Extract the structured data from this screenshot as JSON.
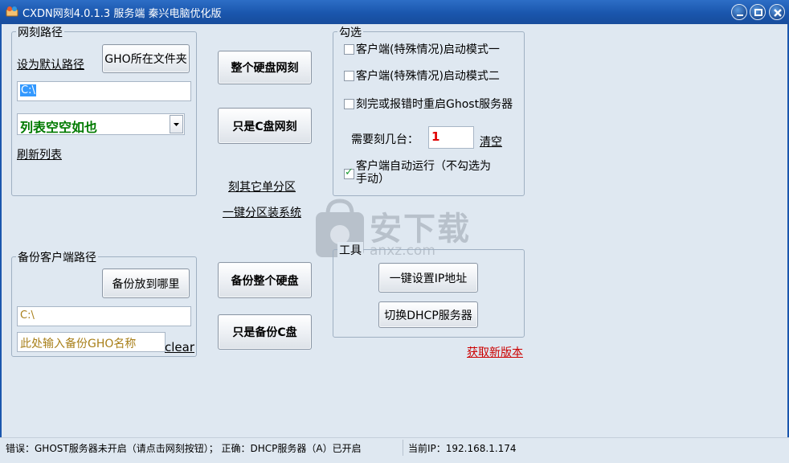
{
  "window": {
    "title": "CXDN网刻4.0.1.3 服务端 秦兴电脑优化版",
    "icon": "app-icon",
    "controls": [
      "minimize-icon",
      "maximize-icon",
      "close-icon"
    ]
  },
  "netclone_path": {
    "legend": "网刻路径",
    "set_default_link": "设为默认路径",
    "gho_folder_button": "GHO所在文件夹",
    "path_value": "C:\\",
    "list_value": "列表空空如也",
    "refresh_link": "刷新列表"
  },
  "center_buttons": {
    "whole_disk_clone": "整个硬盘网刻",
    "c_only_clone": "只是C盘网刻",
    "single_partition_link": "刻其它单分区",
    "one_key_partition_link": "一键分区装系统",
    "backup_whole_disk": "备份整个硬盘",
    "backup_c_only": "只是备份C盘"
  },
  "options": {
    "legend": "勾选",
    "checkboxes": [
      {
        "label": "客户端(特殊情况)启动模式一",
        "checked": false
      },
      {
        "label": "客户端(特殊情况)启动模式二",
        "checked": false
      },
      {
        "label": "刻完或报错时重启Ghost服务器",
        "checked": false
      }
    ],
    "count_label": "需要刻几台：",
    "count_value": "1",
    "clear_link": "清空",
    "auto_run": {
      "label_line1": "客户端自动运行（不勾选为",
      "label_line2": "手动）",
      "checked": true
    }
  },
  "backup_path": {
    "legend": "备份客户端路径",
    "where_button": "备份放到哪里",
    "path_value": "C:\\",
    "name_placeholder": "此处输入备份GHO名称",
    "clear_link": "clear"
  },
  "tools": {
    "legend": "工具",
    "set_ip_button": "一键设置IP地址",
    "dhcp_button": "切换DHCP服务器"
  },
  "update_link": "获取新版本",
  "status_bar": {
    "message": "错误：GHOST服务器未开启（请点击网刻按钮）； 正确：DHCP服务器（A）已开启",
    "ip_text": "当前IP：192.168.1.174"
  },
  "watermark": {
    "cn": "安下载",
    "en": "anxz.com"
  },
  "colors": {
    "titlebar": "#1a56ad",
    "client_bg": "#dfe8f1",
    "list_text": "#007a00",
    "red_link": "#cc0000",
    "count_text": "#e00000"
  }
}
